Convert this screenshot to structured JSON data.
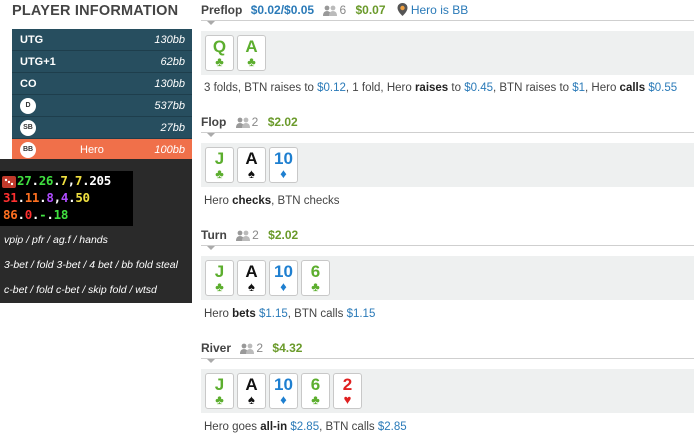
{
  "player_panel": {
    "title": "PLAYER INFORMATION",
    "players": [
      {
        "position": "UTG",
        "stack": "130bb"
      },
      {
        "position": "UTG+1",
        "stack": "62bb"
      },
      {
        "position": "CO",
        "stack": "130bb"
      },
      {
        "position": "D",
        "stack": "537bb"
      },
      {
        "position": "SB",
        "stack": "27bb"
      },
      {
        "position": "BB",
        "name": "Hero",
        "stack": "100bb"
      }
    ]
  },
  "hud": {
    "line1": [
      "27",
      ".",
      "26",
      ".",
      "7",
      ",",
      "7",
      ".",
      "205"
    ],
    "line2": [
      "31",
      ".",
      "11",
      ".",
      "8",
      ",",
      "4",
      ".",
      "50"
    ],
    "line3": [
      "86",
      ".",
      "0",
      ".",
      "-",
      ".",
      "18"
    ],
    "labels": [
      "vpip / pfr / ag.f / hands",
      "3-bet / fold 3-bet / 4 bet / bb fold steal",
      "c-bet / fold c-bet / skip fold / wtsd"
    ],
    "colors": {
      "green": "#40e040",
      "yellow": "#f0e040",
      "red": "#ff3030",
      "orange": "#ff7020",
      "white": "#ffffff",
      "purple": "#b04cff"
    }
  },
  "hand": {
    "preflop": {
      "name": "Preflop",
      "blinds": "$0.02/$0.05",
      "players": "6",
      "pot": "$0.07",
      "hero_note": "Hero is BB",
      "cards": [
        {
          "rank": "Q",
          "suit": "♣"
        },
        {
          "rank": "A",
          "suit": "♣"
        }
      ],
      "action": {
        "t1": "3 folds, BTN raises to ",
        "v1": "$0.12",
        "t2": ", 1 fold, Hero ",
        "b1": "raises",
        "t3": " to ",
        "v2": "$0.45",
        "t4": ", BTN raises to ",
        "v3": "$1",
        "t5": ", Hero ",
        "b2": "calls",
        "t6": " ",
        "v4": "$0.55"
      }
    },
    "flop": {
      "name": "Flop",
      "players": "2",
      "pot": "$2.02",
      "cards": [
        {
          "rank": "J",
          "suit": "♣"
        },
        {
          "rank": "A",
          "suit": "♠"
        },
        {
          "rank": "10",
          "suit": "♦"
        }
      ],
      "action": {
        "t1": "Hero ",
        "b1": "checks",
        "t2": ", BTN checks"
      }
    },
    "turn": {
      "name": "Turn",
      "players": "2",
      "pot": "$2.02",
      "cards": [
        {
          "rank": "J",
          "suit": "♣"
        },
        {
          "rank": "A",
          "suit": "♠"
        },
        {
          "rank": "10",
          "suit": "♦"
        },
        {
          "rank": "6",
          "suit": "♣"
        }
      ],
      "action": {
        "t1": "Hero ",
        "b1": "bets",
        "t2": " ",
        "v1": "$1.15",
        "t3": ", BTN calls ",
        "v2": "$1.15"
      }
    },
    "river": {
      "name": "River",
      "players": "2",
      "pot": "$4.32",
      "cards": [
        {
          "rank": "J",
          "suit": "♣"
        },
        {
          "rank": "A",
          "suit": "♠"
        },
        {
          "rank": "10",
          "suit": "♦"
        },
        {
          "rank": "6",
          "suit": "♣"
        },
        {
          "rank": "2",
          "suit": "♥"
        }
      ],
      "action": {
        "t1": "Hero goes ",
        "b1": "all-in",
        "t2": " ",
        "v1": "$2.85",
        "t3": ", BTN calls ",
        "v2": "$2.85"
      }
    }
  }
}
